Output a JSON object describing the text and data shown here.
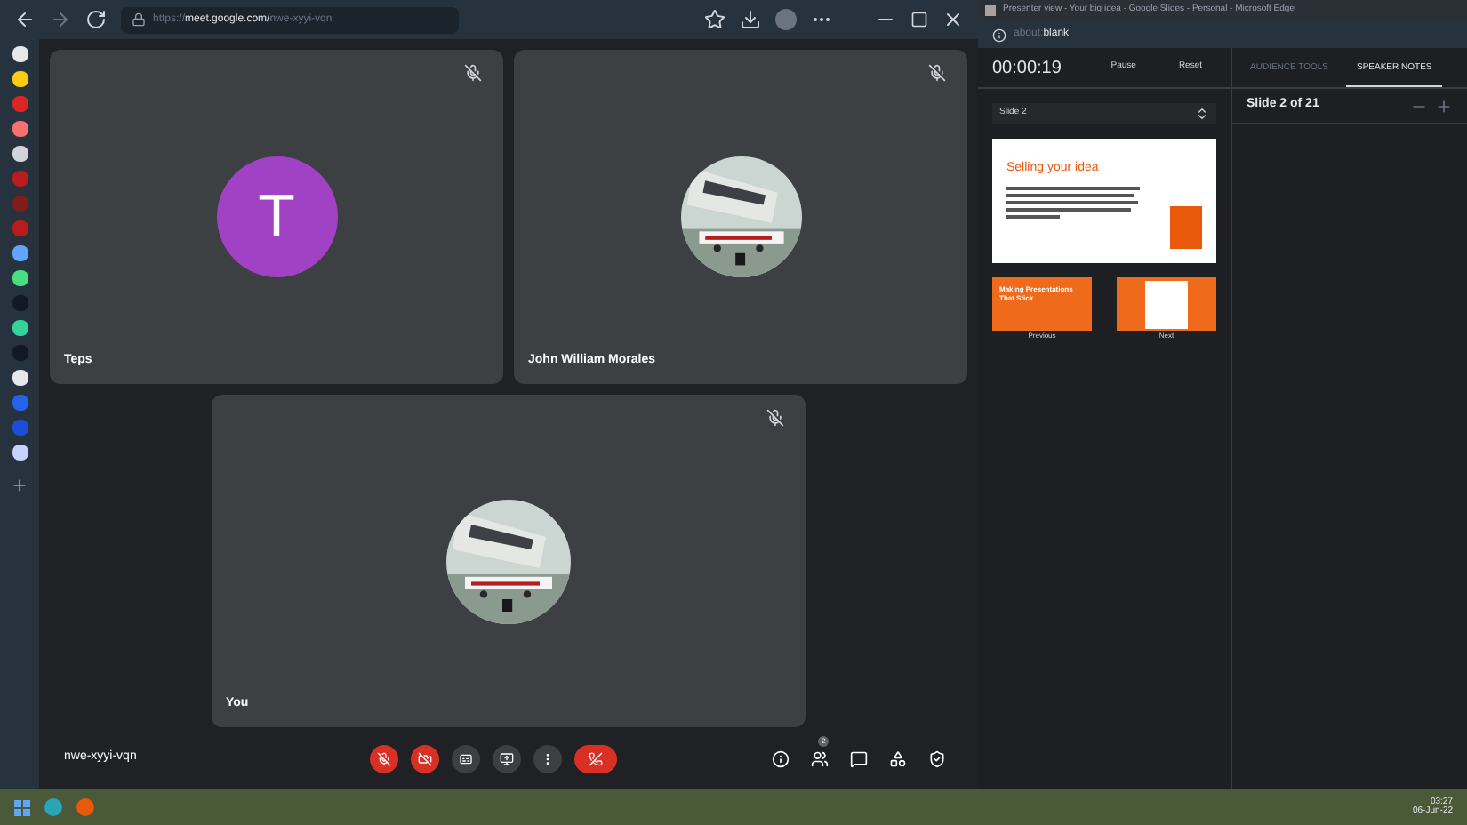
{
  "browser": {
    "url_host": "https://meet.google.com/",
    "url_path": "nwe-xyyi-vqn"
  },
  "sidebar": {
    "items": [
      {
        "color": "#e5e7eb"
      },
      {
        "color": "#facc15"
      },
      {
        "color": "#dc2626"
      },
      {
        "color": "#f87171"
      },
      {
        "color": "#d1d5db"
      },
      {
        "color": "#b91c1c"
      },
      {
        "color": "#7f1d1d"
      },
      {
        "color": "#b91c1c"
      },
      {
        "color": "#60a5fa"
      },
      {
        "color": "#4ade80"
      },
      {
        "color": "#111827"
      },
      {
        "color": "#34d399"
      },
      {
        "color": "#111827"
      },
      {
        "color": "#e5e7eb"
      },
      {
        "color": "#2563eb"
      },
      {
        "color": "#1d4ed8"
      },
      {
        "color": "#c7d2fe"
      }
    ]
  },
  "tiles": [
    {
      "name": "Teps",
      "kind": "letter",
      "letter": "T"
    },
    {
      "name": "John William Morales",
      "kind": "picture"
    },
    {
      "name": "You",
      "kind": "picture"
    }
  ],
  "meeting_code": "nwe-xyyi-vqn",
  "controls": [
    {
      "kind": "mic",
      "off": true
    },
    {
      "kind": "camera",
      "off": true
    },
    {
      "kind": "captions",
      "off": false
    },
    {
      "kind": "present",
      "off": false
    },
    {
      "kind": "more",
      "off": false
    },
    {
      "kind": "hangup"
    }
  ],
  "people_count": "2",
  "presenter": {
    "window_title": "Presenter view - Your big idea - Google Slides - Personal - Microsoft Edge",
    "address_scheme": "about:",
    "address_page": "blank",
    "timer": "00:00:19",
    "pause": "Pause",
    "reset": "Reset",
    "tabs": [
      {
        "label": "AUDIENCE TOOLS",
        "selected": false
      },
      {
        "label": "SPEAKER NOTES",
        "selected": true
      }
    ],
    "slide_select": "Slide 2",
    "slide_counter": "Slide 2 of 21",
    "current_slide_title": "Selling your idea",
    "previous_title": "Making Presentations That Stick",
    "previous": "Previous",
    "next": "Next"
  },
  "clock": {
    "time": "03:27",
    "date": "06-Jun-22"
  }
}
